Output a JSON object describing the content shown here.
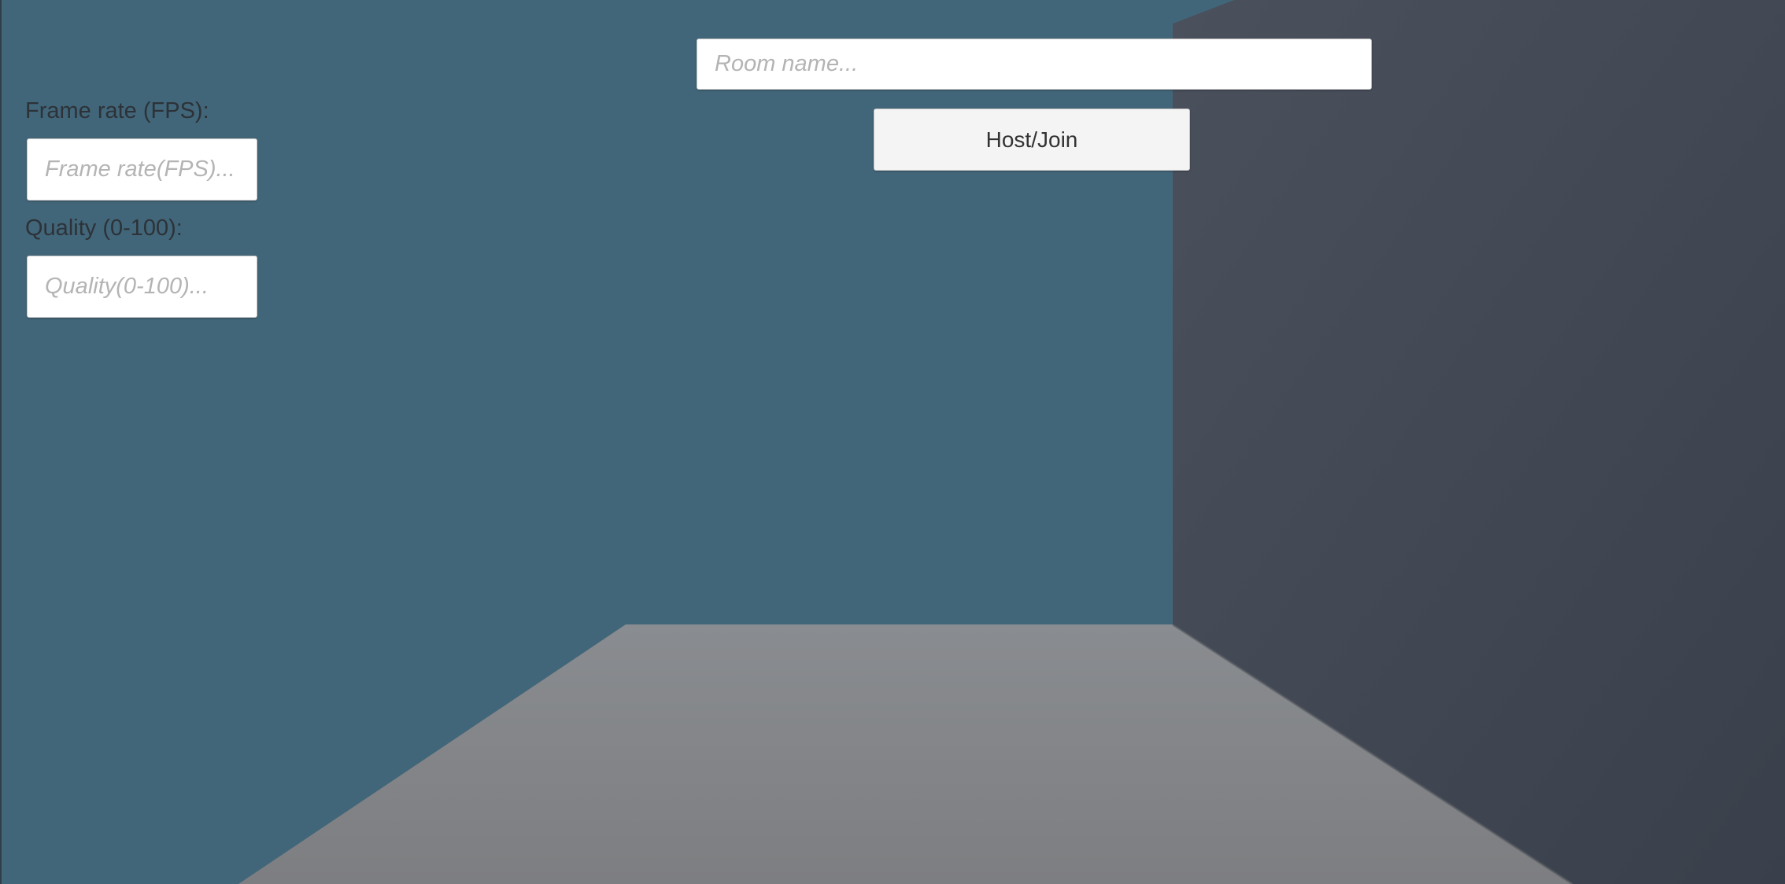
{
  "settings": {
    "fps_label": "Frame rate (FPS):",
    "fps_placeholder": "Frame rate(FPS)...",
    "quality_label": "Quality (0-100):",
    "quality_placeholder": "Quality(0-100)..."
  },
  "room": {
    "name_placeholder": "Room name...",
    "host_join_label": "Host/Join"
  },
  "colors": {
    "back_wall": "#426679",
    "side_wall": "#424855",
    "floor": "#86888c"
  }
}
